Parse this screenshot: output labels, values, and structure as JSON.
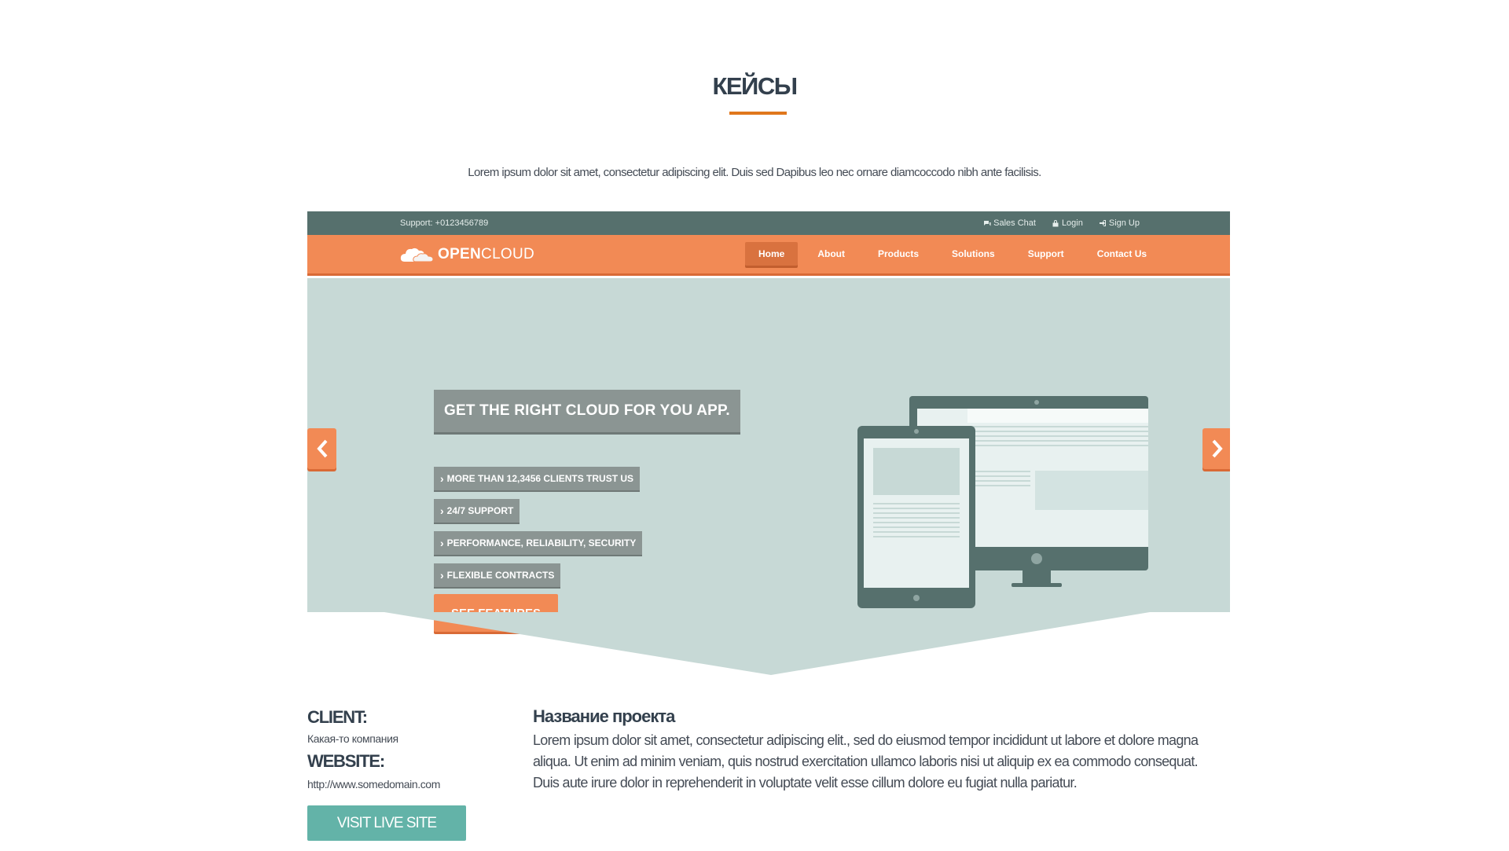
{
  "section": {
    "title": "КЕЙСЫ",
    "intro": "Lorem ipsum dolor sit amet, consectetur adipiscing elit. Duis sed Dapibus leo nec ornare diamcoccodo nibh ante facilisis."
  },
  "preview": {
    "topbar": {
      "support": "Support: +0123456789",
      "links": [
        "Sales Chat",
        "Login",
        "Sign Up"
      ]
    },
    "logo": {
      "bold": "OPEN",
      "light": "CLOUD"
    },
    "menu": [
      "Home",
      "About",
      "Products",
      "Solutions",
      "Support",
      "Contact Us"
    ],
    "active_menu": "Home",
    "headline": "GET THE RIGHT CLOUD FOR YOU APP.",
    "features": [
      "MORE THAN 12,3456 CLIENTS TRUST US",
      "24/7 SUPPORT",
      "PERFORMANCE, RELIABILITY, SECURITY",
      "FLEXIBLE CONTRACTS"
    ],
    "cta": "SEE FEATURES",
    "colors": {
      "accent": "#f28a55",
      "topbar": "#56706d",
      "hero": "#c7d9d6",
      "badge": "#8b9593"
    }
  },
  "details": {
    "client_label": "CLIENT:",
    "client_value": "Какая-то компания",
    "website_label": "WEBSITE:",
    "website_value": "http://www.somedomain.com",
    "visit_button": "VISIT LIVE SITE",
    "project_title": "Название проекта",
    "project_description": "Lorem ipsum dolor sit amet, consectetur adipiscing elit., sed do eiusmod tempor incididunt ut labore et dolore magna aliqua. Ut enim ad minim veniam, quis nostrud exercitation ullamco laboris nisi ut aliquip ex ea commodo consequat. Duis aute irure dolor in reprehenderit in voluptate velit esse cillum dolore eu fugiat nulla pariatur."
  },
  "colors": {
    "title_underline": "#e0771c",
    "visit_button": "#63b3a8"
  }
}
